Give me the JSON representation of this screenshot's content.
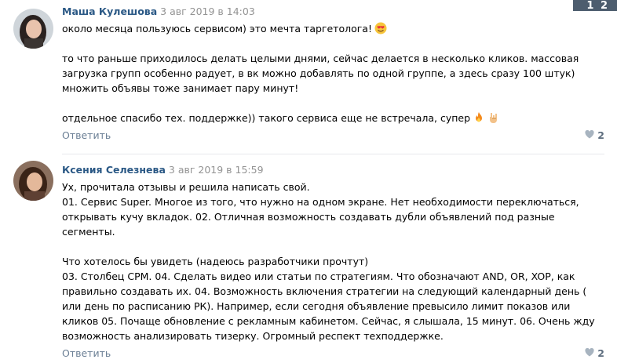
{
  "pagination": {
    "label": "1 2"
  },
  "comments": [
    {
      "author": "Маша Кулешова",
      "date": "3 авг 2019 в 14:03",
      "lines": [
        "около месяца пользуюсь сервисом) это мечта таргетолога!",
        "",
        "то что раньше приходилось делать целыми днями, сейчас делается в несколько кликов. массовая загрузка групп особенно радует, в вк можно добавлять по одной группе, а здесь сразу 100 штук) множить объявы тоже занимает пару минут!",
        "",
        "отдельное спасибо тех. поддержке)) такого сервиса еще не встречала, супер"
      ],
      "emojis": [
        "heart-eyes-emoji",
        "fire-emoji",
        "rock-hand-emoji"
      ],
      "reply_label": "Ответить",
      "likes": "2"
    },
    {
      "author": "Ксения Селезнева",
      "date": "3 авг 2019 в 15:59",
      "lines": [
        "Ух, прочитала отзывы и решила написать свой.",
        "01. Сервис Super. Многое из того, что нужно на одном экране. Нет необходимости переключаться, открывать кучу вкладок. 02. Отличная возможность создавать дубли объявлений под разные сегменты.",
        "",
        "Что хотелось бы увидеть (надеюсь разработчики прочтут)",
        "03. Столбец CPM. 04. Сделать видео или статьи по стратегиям. Что обозначают AND, OR, XOP, как правильно создавать их. 04. Возможность включения стратегии на следующий календарный день ( или день по расписанию РК). Например, если сегодня объявление превысило лимит показов или кликов 05. Почаще обновление с рекламным кабинетом. Сейчас, я слышала, 15 минут. 06. Очень жду возможность анализировать тизерку. Огромный респект техподдержке."
      ],
      "reply_label": "Ответить",
      "likes": "2"
    }
  ]
}
